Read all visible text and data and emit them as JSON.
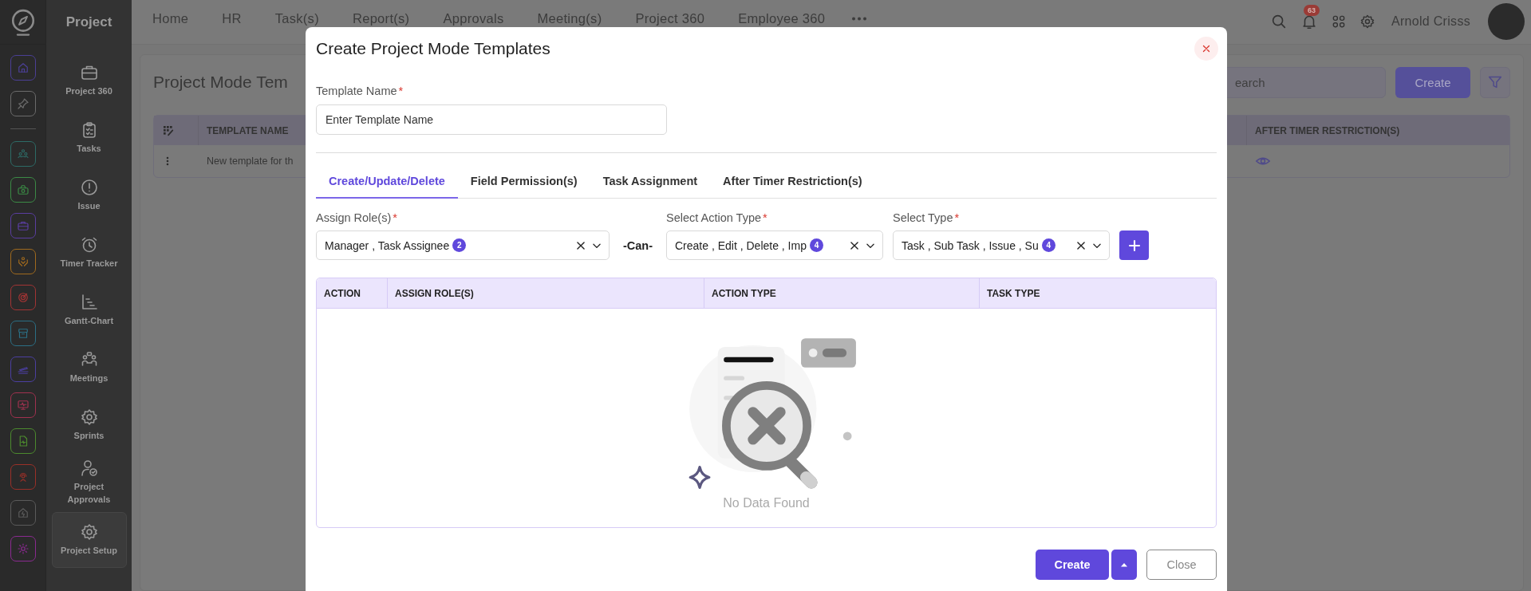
{
  "sidebar": {
    "title": "Project",
    "items": [
      {
        "label": "Project 360",
        "selected": false
      },
      {
        "label": "Tasks",
        "selected": false
      },
      {
        "label": "Issue",
        "selected": false
      },
      {
        "label": "Timer Tracker",
        "selected": false
      },
      {
        "label": "Gantt-Chart",
        "selected": false
      },
      {
        "label": "Meetings",
        "selected": false
      },
      {
        "label": "Sprints",
        "selected": false
      },
      {
        "label": "Project Approvals",
        "selected": false
      },
      {
        "label": "Project Setup",
        "selected": true
      }
    ]
  },
  "top_nav": {
    "items": [
      "Home",
      "HR",
      "Task(s)",
      "Report(s)",
      "Approvals",
      "Meeting(s)",
      "Project 360",
      "Employee 360"
    ],
    "notification_count": "63",
    "user_name": "Arnold Crisss"
  },
  "page": {
    "title": "Project Mode Tem",
    "search": {
      "placeholder": "earch"
    },
    "create_button": "Create",
    "table": {
      "columns": [
        "TEMPLATE NAME",
        "AFTER TIMER RESTRICTION(S)"
      ],
      "rows": [
        {
          "template_name": "New template for th"
        }
      ]
    }
  },
  "modal": {
    "title": "Create Project Mode Templates",
    "template_name": {
      "label": "Template Name",
      "required_mark": "*",
      "placeholder": "Enter Template Name"
    },
    "tabs": [
      {
        "label": "Create/Update/Delete",
        "selected": true
      },
      {
        "label": "Field Permission(s)",
        "selected": false
      },
      {
        "label": "Task Assignment",
        "selected": false
      },
      {
        "label": "After Timer Restriction(s)",
        "selected": false
      }
    ],
    "selects": [
      {
        "label": "Assign Role(s)",
        "required_mark": "*",
        "value": "Manager , Task Assignee",
        "count": "2"
      },
      {
        "label": "Select Action Type",
        "required_mark": "*",
        "value": "Create , Edit , Delete , Imp",
        "count": "4"
      },
      {
        "label": "Select Type",
        "required_mark": "*",
        "value": "Task , Sub Task , Issue , Su",
        "count": "4"
      }
    ],
    "connector": "-Can-",
    "table": {
      "columns": [
        "ACTION",
        "ASSIGN ROLE(S)",
        "ACTION TYPE",
        "TASK TYPE"
      ],
      "empty_text": "No Data Found"
    },
    "buttons": {
      "create": "Create",
      "close": "Close"
    }
  }
}
